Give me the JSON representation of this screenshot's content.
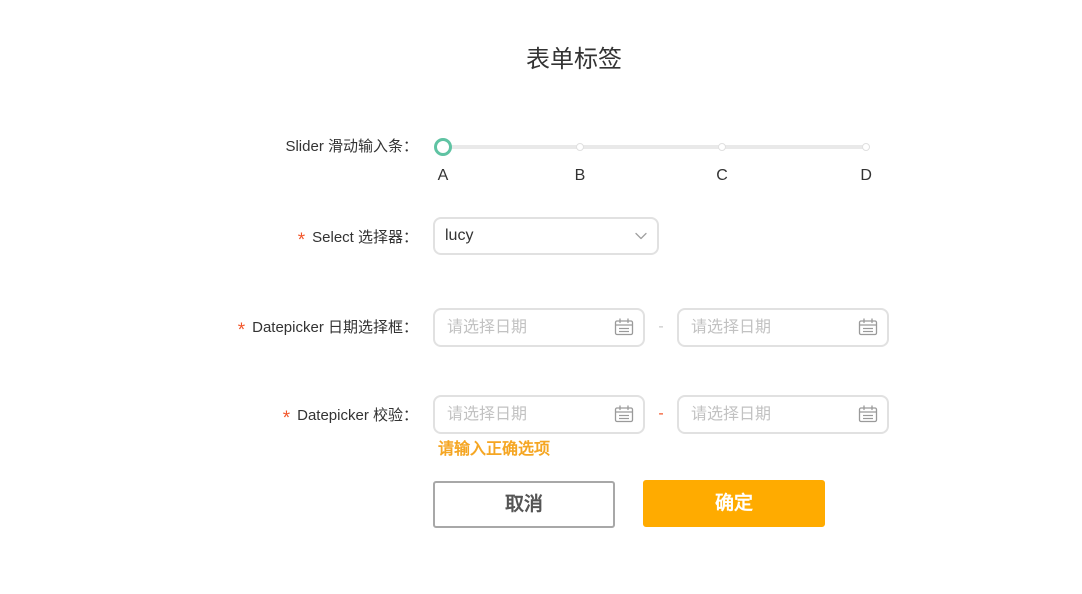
{
  "form": {
    "title": "表单标签",
    "slider": {
      "label": "Slider 滑动输入条：",
      "marks": [
        "A",
        "B",
        "C",
        "D"
      ],
      "value": 0
    },
    "select": {
      "required_mark": "*",
      "label": "Select 选择器：",
      "value": "lucy"
    },
    "date_range": {
      "required_mark": "*",
      "label": "Datepicker 日期选择框：",
      "start_placeholder": "请选择日期",
      "separator": "-",
      "end_placeholder": "请选择日期"
    },
    "date_range_validated": {
      "required_mark": "*",
      "label": "Datepicker 校验：",
      "start_placeholder": "请选择日期",
      "separator": "-",
      "end_placeholder": "请选择日期",
      "error_message": "请输入正确选项"
    },
    "actions": {
      "cancel_label": "取消",
      "confirm_label": "确定"
    }
  },
  "icons": {
    "select_arrow": "chevron-down-icon",
    "date_picker": "calendar-icon"
  },
  "colors": {
    "primary": "#ffab00",
    "required": "#f2572b",
    "error": "#f5a623",
    "slider_handle": "#5fc3a3",
    "text": "#333333",
    "placeholder": "#c2c2c2",
    "border": "#e1e1e1"
  }
}
